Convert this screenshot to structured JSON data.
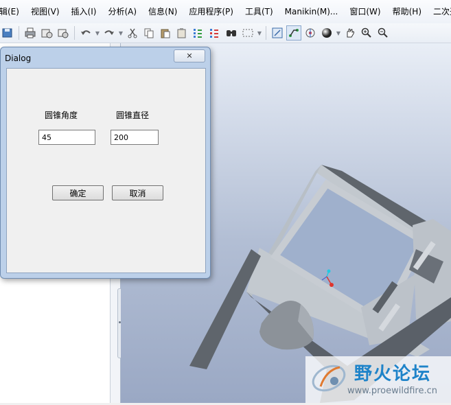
{
  "menubar": {
    "items": [
      "辑(E)",
      "视图(V)",
      "插入(I)",
      "分析(A)",
      "信息(N)",
      "应用程序(P)",
      "工具(T)",
      "Manikin(M)...",
      "窗口(W)",
      "帮助(H)",
      "二次开发"
    ]
  },
  "toolbar": {
    "icons": [
      "save-icon",
      "print-icon",
      "lock-icon",
      "window-icon",
      "undo-icon",
      "redo-icon",
      "cut-icon",
      "copy-icon",
      "paste-icon",
      "paste-special-icon",
      "regenerate-icon",
      "regenerate-manager-icon",
      "find-icon",
      "select-box-icon",
      "view-icon",
      "datum-icon",
      "spin-center-icon",
      "shading-icon",
      "pan-icon",
      "zoom-in-icon",
      "zoom-out-icon"
    ]
  },
  "dialog": {
    "title": "Dialog",
    "close_label": "✕",
    "cone_angle_label": "圆锥角度",
    "cone_diameter_label": "圆锥直径",
    "cone_angle_value": "45",
    "cone_diameter_value": "200",
    "ok_label": "确定",
    "cancel_label": "取消"
  },
  "watermark": {
    "title": "野火论坛",
    "url": "www.proewildfire.cn"
  },
  "colors": {
    "model_gray": "#6b7077",
    "model_light": "#c3c8ce",
    "axis_red": "#e0342c",
    "axis_cyan": "#22c8e0"
  }
}
